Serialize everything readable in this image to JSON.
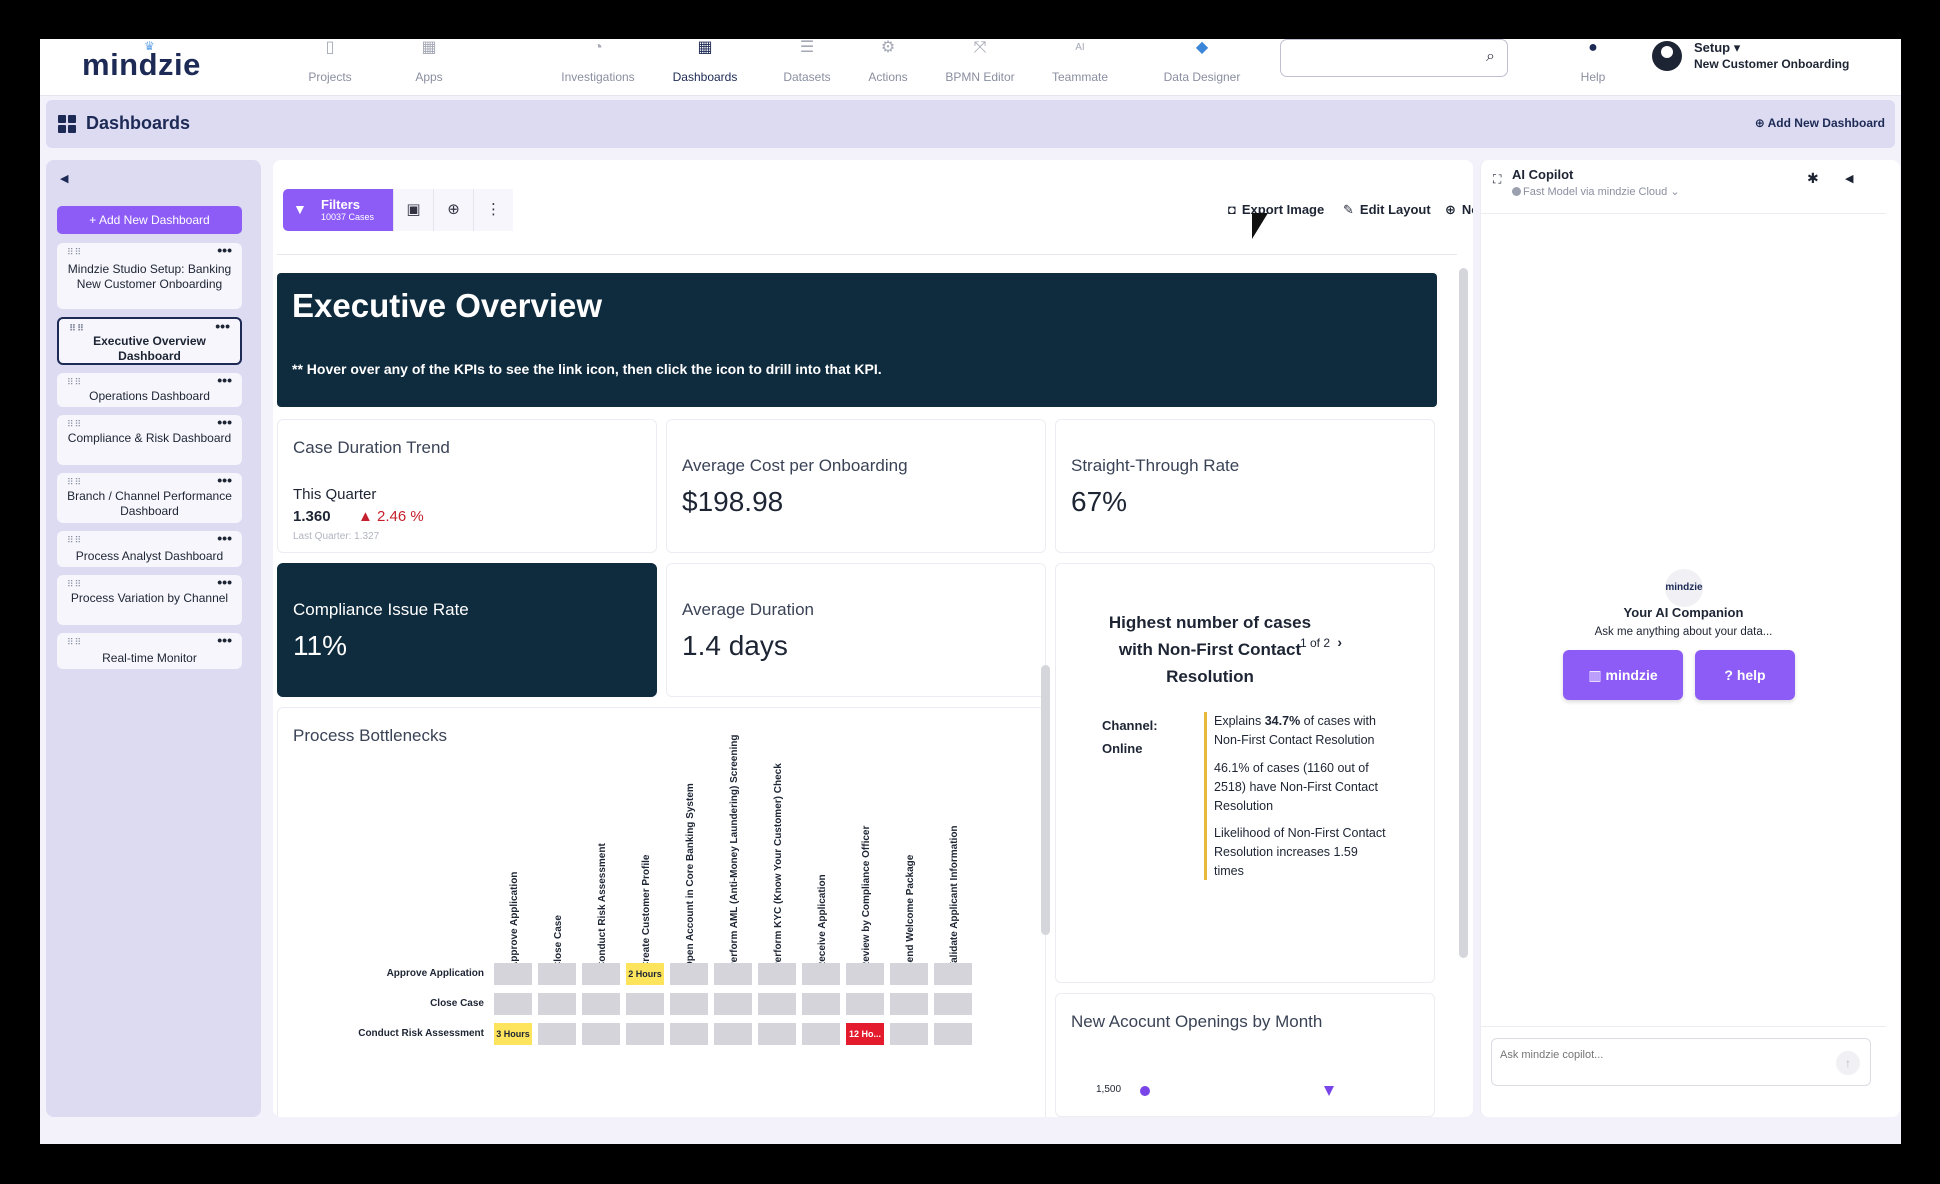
{
  "app": {
    "logo": "mindzie"
  },
  "nav": {
    "items": [
      {
        "label": "Projects",
        "icon": "document-icon"
      },
      {
        "label": "Apps",
        "icon": "apps-icon"
      },
      {
        "label": "Investigations",
        "icon": "pie-icon"
      },
      {
        "label": "Dashboards",
        "icon": "grid-icon"
      },
      {
        "label": "Datasets",
        "icon": "database-icon"
      },
      {
        "label": "Actions",
        "icon": "gear-icon"
      },
      {
        "label": "BPMN Editor",
        "icon": "flow-icon"
      },
      {
        "label": "Teammate",
        "prefix": "AI",
        "icon": "chat-icon"
      },
      {
        "label": "Data Designer",
        "icon": "cube-icon"
      },
      {
        "label": "Help",
        "icon": "help-icon"
      }
    ],
    "search_placeholder": "",
    "setup": {
      "title": "Setup",
      "subtitle": "New Customer Onboarding"
    }
  },
  "header": {
    "title": "Dashboards",
    "add_new": "Add New Dashboard"
  },
  "sidebar": {
    "add_button": "+ Add New Dashboard",
    "items": [
      {
        "label": "Mindzie Studio Setup: Banking New Customer Onboarding"
      },
      {
        "label": "Executive Overview Dashboard",
        "active": true
      },
      {
        "label": "Operations Dashboard"
      },
      {
        "label": "Compliance & Risk Dashboard"
      },
      {
        "label": "Branch / Channel Performance Dashboard"
      },
      {
        "label": "Process Analyst Dashboard"
      },
      {
        "label": "Process Variation by Channel"
      },
      {
        "label": "Real-time Monitor"
      }
    ]
  },
  "toolbar": {
    "filters_label": "Filters",
    "filters_count": "10037 Cases",
    "export_image": "Export Image",
    "edit_layout": "Edit Layout",
    "note": "Note"
  },
  "banner": {
    "title": "Executive Overview",
    "subtitle": "** Hover over any of the KPIs to see the link icon, then click the icon to drill into that KPI."
  },
  "kpis": {
    "trend": {
      "title": "Case Duration Trend",
      "period": "This Quarter",
      "value": "1.360",
      "delta": "2.46 %",
      "last": "Last Quarter: 1.327"
    },
    "avg_cost": {
      "title": "Average Cost per Onboarding",
      "value": "$198.98"
    },
    "stp": {
      "title": "Straight-Through Rate",
      "value": "67%"
    },
    "compliance": {
      "title": "Compliance Issue Rate",
      "value": "11%"
    },
    "avg_duration": {
      "title": "Average Duration",
      "value": "1.4 days"
    }
  },
  "bottlenecks": {
    "title": "Process Bottlenecks",
    "columns": [
      "Approve Application",
      "Close Case",
      "Conduct Risk Assessment",
      "Create Customer Profile",
      "Open Account in Core Banking System",
      "Perform AML (Anti-Money Laundering) Screening",
      "Perform KYC (Know Your Customer) Check",
      "Receive Application",
      "Review by Compliance Officer",
      "Send Welcome Package",
      "Validate Applicant Information"
    ],
    "rows": [
      {
        "label": "Approve Application",
        "cells": {
          "3": {
            "text": "2 Hours",
            "tone": "yellow"
          }
        }
      },
      {
        "label": "Close Case",
        "cells": {}
      },
      {
        "label": "Conduct Risk Assessment",
        "cells": {
          "0": {
            "text": "3 Hours",
            "tone": "yellow"
          },
          "8": {
            "text": "12 Ho...",
            "tone": "red"
          }
        }
      }
    ]
  },
  "highest_cases": {
    "title": "Highest number of cases with Non-First Contact Resolution",
    "pager": "1 of 2",
    "channel_label": "Channel:",
    "channel_value": "Online",
    "insight1_pre": "Explains ",
    "insight1_bold": "34.7%",
    "insight1_post": " of cases with Non-First Contact Resolution",
    "insight2": "46.1% of cases (1160 out of 2518) have Non-First Contact Resolution",
    "insight3": "Likelihood of Non-First Contact Resolution increases 1.59 times"
  },
  "openings": {
    "title": "New Acocunt Openings by Month",
    "y_tick": "1,500"
  },
  "copilot": {
    "title": "AI Copilot",
    "model": "Fast Model via mindzie Cloud",
    "logo": "mindzie",
    "companion": "Your AI Companion",
    "ask": "Ask me anything about your data...",
    "btn_mindzie": "mindzie",
    "btn_help": "help",
    "input_placeholder": "Ask mindzie copilot..."
  }
}
